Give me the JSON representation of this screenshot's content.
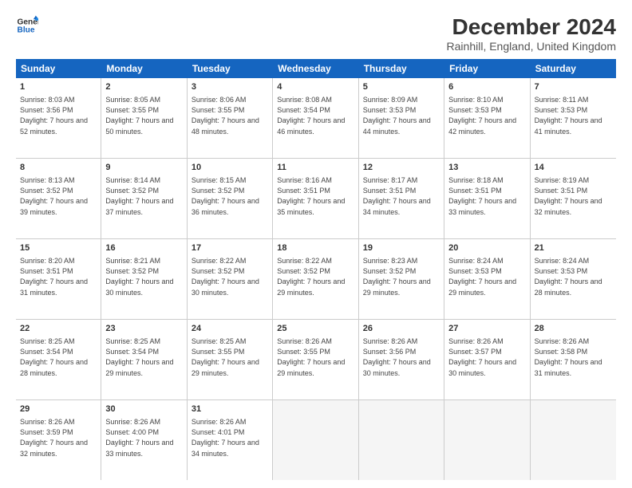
{
  "logo": {
    "line1": "General",
    "line2": "Blue"
  },
  "title": "December 2024",
  "subtitle": "Rainhill, England, United Kingdom",
  "headers": [
    "Sunday",
    "Monday",
    "Tuesday",
    "Wednesday",
    "Thursday",
    "Friday",
    "Saturday"
  ],
  "weeks": [
    [
      {
        "day": "1",
        "sunrise": "Sunrise: 8:03 AM",
        "sunset": "Sunset: 3:56 PM",
        "daylight": "Daylight: 7 hours and 52 minutes."
      },
      {
        "day": "2",
        "sunrise": "Sunrise: 8:05 AM",
        "sunset": "Sunset: 3:55 PM",
        "daylight": "Daylight: 7 hours and 50 minutes."
      },
      {
        "day": "3",
        "sunrise": "Sunrise: 8:06 AM",
        "sunset": "Sunset: 3:55 PM",
        "daylight": "Daylight: 7 hours and 48 minutes."
      },
      {
        "day": "4",
        "sunrise": "Sunrise: 8:08 AM",
        "sunset": "Sunset: 3:54 PM",
        "daylight": "Daylight: 7 hours and 46 minutes."
      },
      {
        "day": "5",
        "sunrise": "Sunrise: 8:09 AM",
        "sunset": "Sunset: 3:53 PM",
        "daylight": "Daylight: 7 hours and 44 minutes."
      },
      {
        "day": "6",
        "sunrise": "Sunrise: 8:10 AM",
        "sunset": "Sunset: 3:53 PM",
        "daylight": "Daylight: 7 hours and 42 minutes."
      },
      {
        "day": "7",
        "sunrise": "Sunrise: 8:11 AM",
        "sunset": "Sunset: 3:53 PM",
        "daylight": "Daylight: 7 hours and 41 minutes."
      }
    ],
    [
      {
        "day": "8",
        "sunrise": "Sunrise: 8:13 AM",
        "sunset": "Sunset: 3:52 PM",
        "daylight": "Daylight: 7 hours and 39 minutes."
      },
      {
        "day": "9",
        "sunrise": "Sunrise: 8:14 AM",
        "sunset": "Sunset: 3:52 PM",
        "daylight": "Daylight: 7 hours and 37 minutes."
      },
      {
        "day": "10",
        "sunrise": "Sunrise: 8:15 AM",
        "sunset": "Sunset: 3:52 PM",
        "daylight": "Daylight: 7 hours and 36 minutes."
      },
      {
        "day": "11",
        "sunrise": "Sunrise: 8:16 AM",
        "sunset": "Sunset: 3:51 PM",
        "daylight": "Daylight: 7 hours and 35 minutes."
      },
      {
        "day": "12",
        "sunrise": "Sunrise: 8:17 AM",
        "sunset": "Sunset: 3:51 PM",
        "daylight": "Daylight: 7 hours and 34 minutes."
      },
      {
        "day": "13",
        "sunrise": "Sunrise: 8:18 AM",
        "sunset": "Sunset: 3:51 PM",
        "daylight": "Daylight: 7 hours and 33 minutes."
      },
      {
        "day": "14",
        "sunrise": "Sunrise: 8:19 AM",
        "sunset": "Sunset: 3:51 PM",
        "daylight": "Daylight: 7 hours and 32 minutes."
      }
    ],
    [
      {
        "day": "15",
        "sunrise": "Sunrise: 8:20 AM",
        "sunset": "Sunset: 3:51 PM",
        "daylight": "Daylight: 7 hours and 31 minutes."
      },
      {
        "day": "16",
        "sunrise": "Sunrise: 8:21 AM",
        "sunset": "Sunset: 3:52 PM",
        "daylight": "Daylight: 7 hours and 30 minutes."
      },
      {
        "day": "17",
        "sunrise": "Sunrise: 8:22 AM",
        "sunset": "Sunset: 3:52 PM",
        "daylight": "Daylight: 7 hours and 30 minutes."
      },
      {
        "day": "18",
        "sunrise": "Sunrise: 8:22 AM",
        "sunset": "Sunset: 3:52 PM",
        "daylight": "Daylight: 7 hours and 29 minutes."
      },
      {
        "day": "19",
        "sunrise": "Sunrise: 8:23 AM",
        "sunset": "Sunset: 3:52 PM",
        "daylight": "Daylight: 7 hours and 29 minutes."
      },
      {
        "day": "20",
        "sunrise": "Sunrise: 8:24 AM",
        "sunset": "Sunset: 3:53 PM",
        "daylight": "Daylight: 7 hours and 29 minutes."
      },
      {
        "day": "21",
        "sunrise": "Sunrise: 8:24 AM",
        "sunset": "Sunset: 3:53 PM",
        "daylight": "Daylight: 7 hours and 28 minutes."
      }
    ],
    [
      {
        "day": "22",
        "sunrise": "Sunrise: 8:25 AM",
        "sunset": "Sunset: 3:54 PM",
        "daylight": "Daylight: 7 hours and 28 minutes."
      },
      {
        "day": "23",
        "sunrise": "Sunrise: 8:25 AM",
        "sunset": "Sunset: 3:54 PM",
        "daylight": "Daylight: 7 hours and 29 minutes."
      },
      {
        "day": "24",
        "sunrise": "Sunrise: 8:25 AM",
        "sunset": "Sunset: 3:55 PM",
        "daylight": "Daylight: 7 hours and 29 minutes."
      },
      {
        "day": "25",
        "sunrise": "Sunrise: 8:26 AM",
        "sunset": "Sunset: 3:55 PM",
        "daylight": "Daylight: 7 hours and 29 minutes."
      },
      {
        "day": "26",
        "sunrise": "Sunrise: 8:26 AM",
        "sunset": "Sunset: 3:56 PM",
        "daylight": "Daylight: 7 hours and 30 minutes."
      },
      {
        "day": "27",
        "sunrise": "Sunrise: 8:26 AM",
        "sunset": "Sunset: 3:57 PM",
        "daylight": "Daylight: 7 hours and 30 minutes."
      },
      {
        "day": "28",
        "sunrise": "Sunrise: 8:26 AM",
        "sunset": "Sunset: 3:58 PM",
        "daylight": "Daylight: 7 hours and 31 minutes."
      }
    ],
    [
      {
        "day": "29",
        "sunrise": "Sunrise: 8:26 AM",
        "sunset": "Sunset: 3:59 PM",
        "daylight": "Daylight: 7 hours and 32 minutes."
      },
      {
        "day": "30",
        "sunrise": "Sunrise: 8:26 AM",
        "sunset": "Sunset: 4:00 PM",
        "daylight": "Daylight: 7 hours and 33 minutes."
      },
      {
        "day": "31",
        "sunrise": "Sunrise: 8:26 AM",
        "sunset": "Sunset: 4:01 PM",
        "daylight": "Daylight: 7 hours and 34 minutes."
      },
      {
        "day": "",
        "sunrise": "",
        "sunset": "",
        "daylight": ""
      },
      {
        "day": "",
        "sunrise": "",
        "sunset": "",
        "daylight": ""
      },
      {
        "day": "",
        "sunrise": "",
        "sunset": "",
        "daylight": ""
      },
      {
        "day": "",
        "sunrise": "",
        "sunset": "",
        "daylight": ""
      }
    ]
  ]
}
